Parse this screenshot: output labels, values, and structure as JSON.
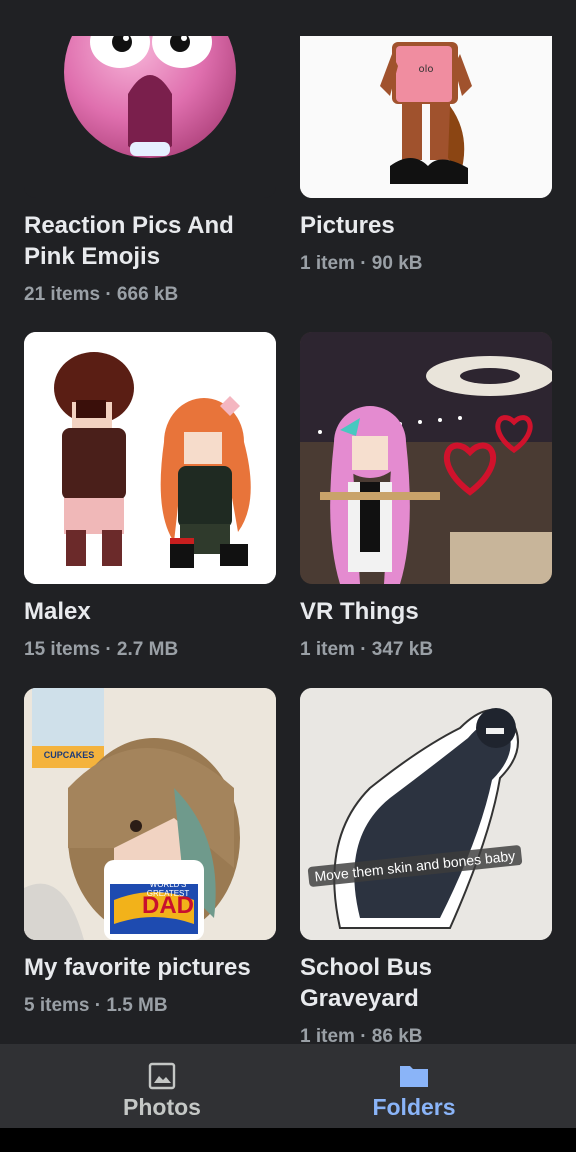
{
  "folders": [
    {
      "title": "Reaction Pics And Pink Emojis",
      "meta": "21 items · 666 kB"
    },
    {
      "title": "Pictures",
      "meta": "1 item · 90 kB"
    },
    {
      "title": "Malex",
      "meta": "15 items · 2.7 MB"
    },
    {
      "title": "VR Things",
      "meta": "1 item · 347 kB"
    },
    {
      "title": "My favorite pictures",
      "meta": "5 items · 1.5 MB"
    },
    {
      "title": "School Bus Graveyard",
      "meta": "1 item · 86 kB"
    }
  ],
  "thumb_text": {
    "mug_line1": "WORLD'S GREATEST",
    "mug_word": "DAD",
    "poster_word": "CUPCAKES",
    "caption": "Move them skin and bones baby"
  },
  "nav": {
    "photos_label": "Photos",
    "folders_label": "Folders",
    "photos_icon": "image-icon",
    "folders_icon": "folder-icon"
  },
  "colors": {
    "background": "#202124",
    "nav_background": "#303134",
    "active": "#8ab4f8",
    "inactive": "#c4c7c5",
    "meta_text": "#9aa0a6"
  }
}
